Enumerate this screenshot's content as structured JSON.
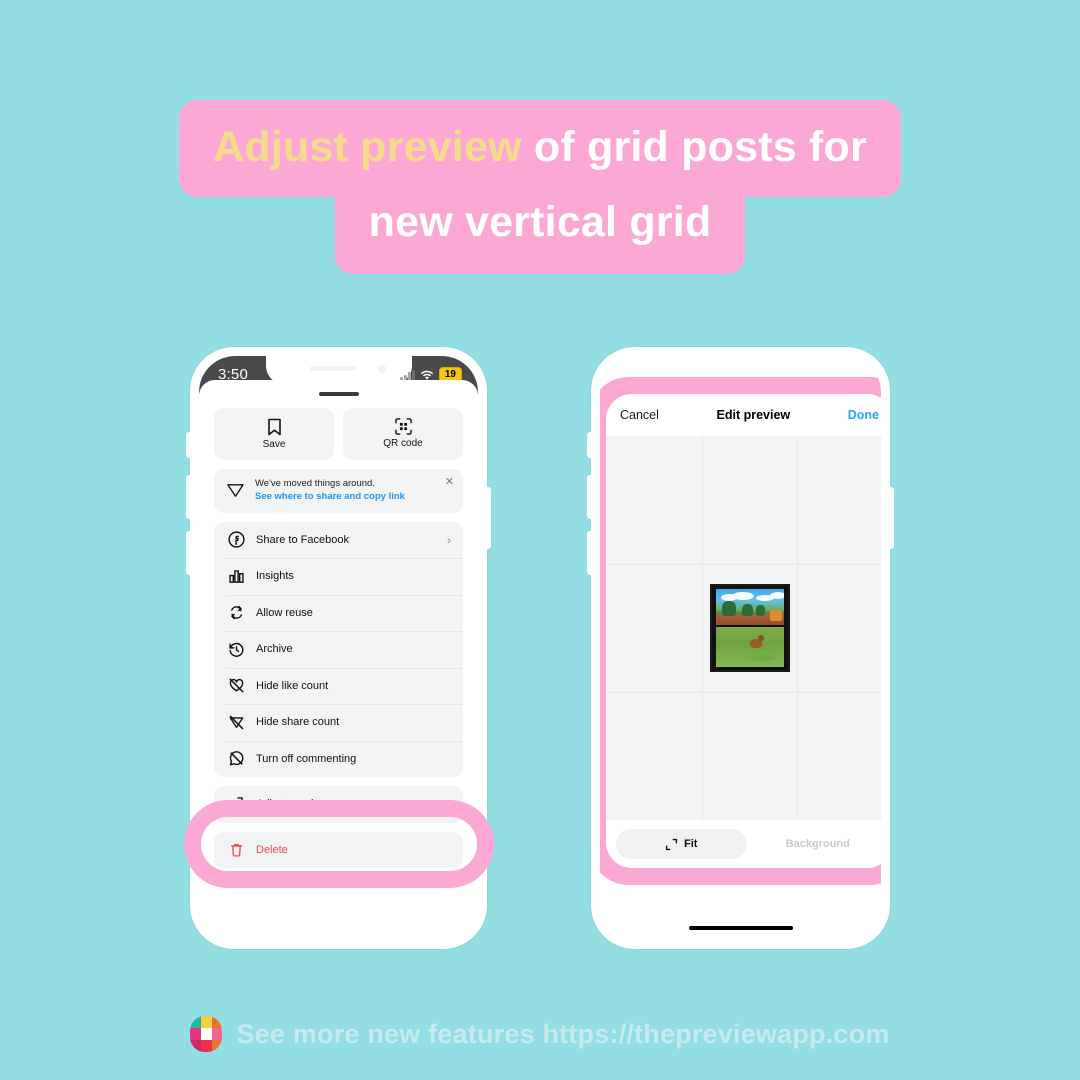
{
  "background_color": "#93DEE2",
  "title": {
    "highlight_text": "Adjust preview",
    "rest_text": "of grid posts for",
    "line2_text": "new vertical grid",
    "highlight_color": "#F5DC8B",
    "text_color": "#FFFFFF",
    "banner_color": "#FBA8D4"
  },
  "phone_left": {
    "status_bar": {
      "time": "3:50",
      "battery": "19",
      "battery_color": "#F5C518",
      "signal_icon": "cellular-signal-icon",
      "wifi_icon": "wifi-icon"
    },
    "quick_actions": [
      {
        "label": "Save",
        "icon": "bookmark-icon"
      },
      {
        "label": "QR code",
        "icon": "qr-code-icon"
      }
    ],
    "notice": {
      "icon": "paper-plane-icon",
      "line1": "We've moved things around.",
      "line2": "See where to share and copy link",
      "link_color": "#2196F3",
      "close_icon": "close-icon"
    },
    "menu_items": [
      {
        "label": "Share to Facebook",
        "icon": "facebook-icon",
        "chevron": "›"
      },
      {
        "label": "Insights",
        "icon": "insights-bar-chart-icon"
      },
      {
        "label": "Allow reuse",
        "icon": "reuse-loop-icon"
      },
      {
        "label": "Archive",
        "icon": "archive-clock-icon"
      },
      {
        "label": "Hide like count",
        "icon": "heart-slash-icon"
      },
      {
        "label": "Hide share count",
        "icon": "paper-plane-slash-icon"
      },
      {
        "label": "Turn off commenting",
        "icon": "comment-slash-icon"
      }
    ],
    "adjust_preview": {
      "label": "Adjust preview",
      "icon": "crop-corners-icon"
    },
    "delete": {
      "label": "Delete",
      "icon": "trash-icon",
      "color": "#ED4956"
    },
    "highlight_ring_color": "#FBA8D4"
  },
  "phone_right": {
    "frame_color": "#FBA8D4",
    "nav": {
      "cancel_label": "Cancel",
      "title": "Edit preview",
      "done_label": "Done",
      "done_color": "#2AA7F0"
    },
    "grid": {
      "columns": 3,
      "rows": 3,
      "cell_background": "#F2F3F5",
      "gridline_color": "#E6E7EA",
      "thumbnail_alt": "outdoor photo split top sky-and-trees, bottom dog-on-grass"
    },
    "tools": [
      {
        "label": "Fit",
        "icon": "crop-corners-icon",
        "state": "active"
      },
      {
        "label": "Background",
        "icon": "",
        "state": "disabled"
      }
    ]
  },
  "footer": {
    "logo_icon": "preview-app-logo-icon",
    "logo_colors": [
      "#2BB3A3",
      "#F2D33C",
      "#E8722E",
      "#E5357F",
      "#FFFFFF",
      "#F4649B",
      "#C9286B",
      "#E8324B",
      "#E86A2E"
    ],
    "text": "See more new features https://thepreviewapp.com",
    "text_color": "#C6EBEC"
  }
}
